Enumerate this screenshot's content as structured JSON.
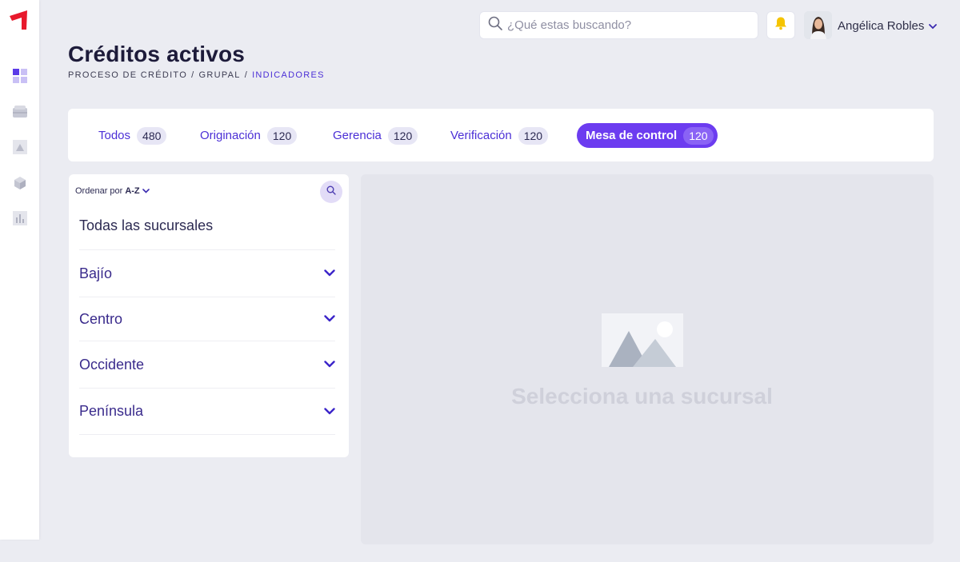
{
  "header": {
    "search_placeholder": "¿Qué estas buscando?",
    "user_name": "Angélica Robles"
  },
  "page": {
    "title": "Créditos activos",
    "breadcrumb": [
      "PROCESO DE CRÉDITO",
      "GRUPAL",
      "INDICADORES"
    ]
  },
  "tabs": [
    {
      "label": "Todos",
      "count": "480"
    },
    {
      "label": "Originación",
      "count": "120"
    },
    {
      "label": "Gerencia",
      "count": "120"
    },
    {
      "label": "Verificación",
      "count": "120"
    },
    {
      "label": "Mesa de control",
      "count": "120",
      "active": true
    }
  ],
  "branches": {
    "sort_label": "Ordenar por",
    "sort_value": "A-Z",
    "all_label": "Todas las sucursales",
    "items": [
      "Bajío",
      "Centro",
      "Occidente",
      "Península"
    ]
  },
  "detail": {
    "empty_message": "Selecciona una sucursal"
  },
  "colors": {
    "accent": "#6c3cf0",
    "brand_logo": "#e8192c",
    "bell": "#f5c400",
    "background": "#ebecf2"
  },
  "icons": {
    "logo": "brand-logo-icon",
    "nav": [
      "dashboard-icon",
      "wallet-icon",
      "triangle-icon",
      "cube-icon",
      "bar-chart-icon"
    ],
    "search": "search-icon",
    "bell": "bell-icon",
    "chevron": "chevron-down-icon",
    "placeholder": "image-placeholder-icon"
  }
}
